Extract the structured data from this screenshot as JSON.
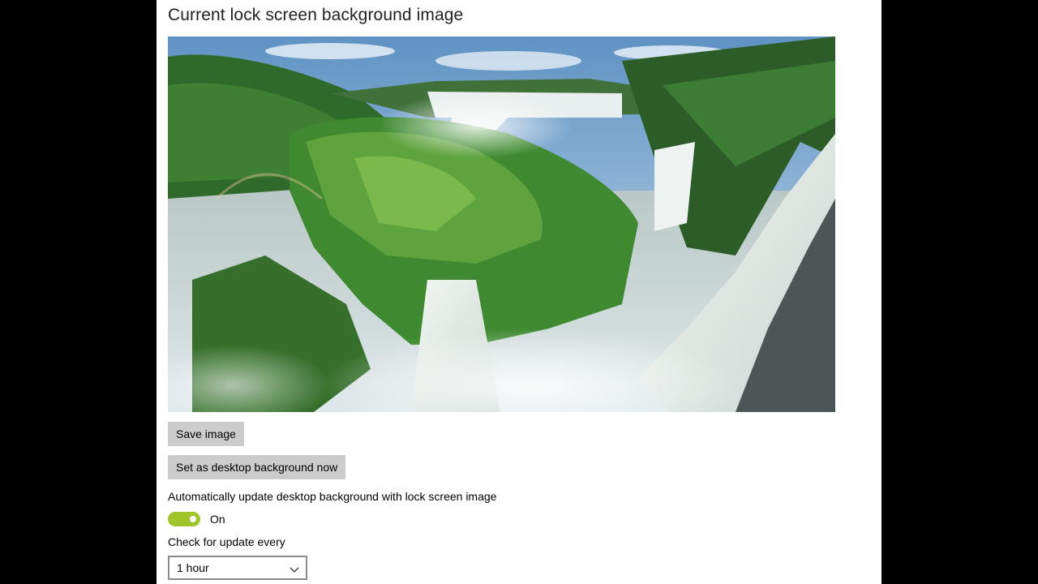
{
  "page": {
    "title": "Current lock screen background image"
  },
  "image": {
    "alt": "Waterfalls lock screen image",
    "subject": "waterfall landscape"
  },
  "buttons": {
    "save_image": "Save image",
    "set_desktop": "Set as desktop background now"
  },
  "auto_update": {
    "label": "Automatically update desktop background with lock screen image",
    "toggle_state": "On",
    "toggle_on": true
  },
  "check_interval": {
    "label": "Check for update every",
    "selected": "1 hour"
  },
  "colors": {
    "toggle_accent": "#9fc52a",
    "button_bg": "#cccccc",
    "panel_bg": "#ffffff",
    "backdrop": "#000000"
  },
  "icons": {
    "dropdown": "chevron-down-icon"
  }
}
